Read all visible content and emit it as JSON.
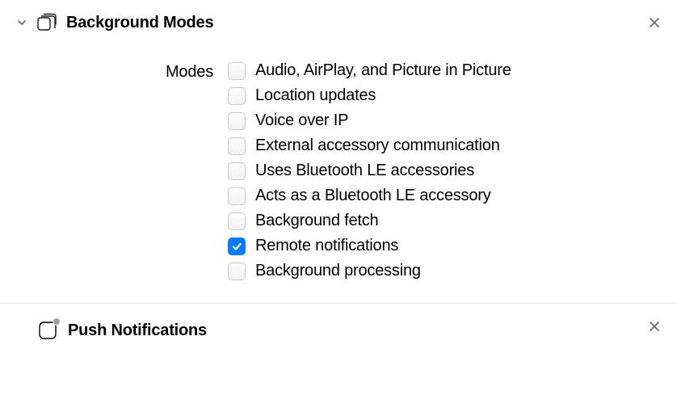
{
  "panels": {
    "backgroundModes": {
      "title": "Background Modes",
      "modesLabel": "Modes",
      "items": [
        {
          "label": "Audio, AirPlay, and Picture in Picture",
          "checked": false
        },
        {
          "label": "Location updates",
          "checked": false
        },
        {
          "label": "Voice over IP",
          "checked": false
        },
        {
          "label": "External accessory communication",
          "checked": false
        },
        {
          "label": "Uses Bluetooth LE accessories",
          "checked": false
        },
        {
          "label": "Acts as a Bluetooth LE accessory",
          "checked": false
        },
        {
          "label": "Background fetch",
          "checked": false
        },
        {
          "label": "Remote notifications",
          "checked": true
        },
        {
          "label": "Background processing",
          "checked": false
        }
      ]
    },
    "pushNotifications": {
      "title": "Push Notifications"
    }
  }
}
